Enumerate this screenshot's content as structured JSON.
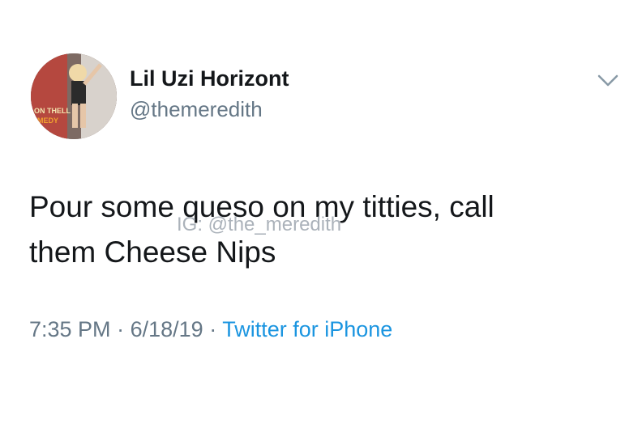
{
  "user": {
    "display_name": "Lil Uzi Horizont",
    "handle": "@themeredith",
    "avatar_text": "ON THELL MEDY"
  },
  "tweet": {
    "text_line1": "Pour some queso on my titties, call",
    "text_line2": "them Cheese Nips",
    "watermark": "IG: @the_meredith",
    "time": "7:35 PM",
    "date": "6/18/19",
    "separator": "·",
    "source": "Twitter for iPhone"
  },
  "icons": {
    "menu": "chevron-down-icon"
  },
  "colors": {
    "text": "#14171a",
    "secondary": "#657786",
    "link": "#1b95e0",
    "background": "#ffffff"
  }
}
